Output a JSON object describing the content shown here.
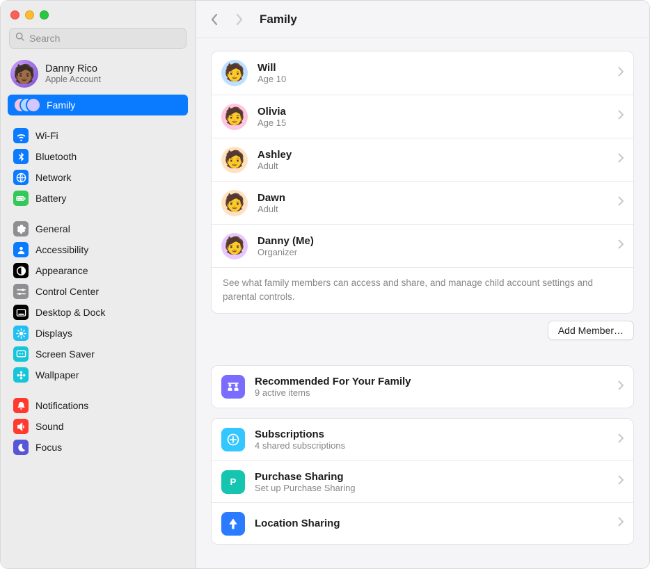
{
  "search": {
    "placeholder": "Search"
  },
  "account": {
    "name": "Danny Rico",
    "sub": "Apple Account"
  },
  "sidebar": {
    "family_label": "Family",
    "groups": [
      [
        {
          "label": "Wi-Fi",
          "color": "#0a7aff",
          "icon": "wifi"
        },
        {
          "label": "Bluetooth",
          "color": "#0a7aff",
          "icon": "bluetooth"
        },
        {
          "label": "Network",
          "color": "#0a7aff",
          "icon": "globe"
        },
        {
          "label": "Battery",
          "color": "#34c759",
          "icon": "battery"
        }
      ],
      [
        {
          "label": "General",
          "color": "#8e8e93",
          "icon": "gear"
        },
        {
          "label": "Accessibility",
          "color": "#0a7aff",
          "icon": "person"
        },
        {
          "label": "Appearance",
          "color": "#000000",
          "icon": "half"
        },
        {
          "label": "Control Center",
          "color": "#8e8e93",
          "icon": "sliders"
        },
        {
          "label": "Desktop & Dock",
          "color": "#000000",
          "icon": "dock"
        },
        {
          "label": "Displays",
          "color": "#23bff2",
          "icon": "sun"
        },
        {
          "label": "Screen Saver",
          "color": "#16c5d9",
          "icon": "screensaver"
        },
        {
          "label": "Wallpaper",
          "color": "#16c5d9",
          "icon": "flower"
        }
      ],
      [
        {
          "label": "Notifications",
          "color": "#ff3b30",
          "icon": "bell"
        },
        {
          "label": "Sound",
          "color": "#ff3b30",
          "icon": "speaker"
        },
        {
          "label": "Focus",
          "color": "#5856d6",
          "icon": "moon"
        }
      ]
    ]
  },
  "page": {
    "title": "Family"
  },
  "members": [
    {
      "name": "Will",
      "sub": "Age 10",
      "bg": "#bde0ff"
    },
    {
      "name": "Olivia",
      "sub": "Age 15",
      "bg": "#ffc4de"
    },
    {
      "name": "Ashley",
      "sub": "Adult",
      "bg": "#ffe1c0"
    },
    {
      "name": "Dawn",
      "sub": "Adult",
      "bg": "#ffe1c0"
    },
    {
      "name": "Danny (Me)",
      "sub": "Organizer",
      "bg": "#e6c8ff"
    }
  ],
  "members_footnote": "See what family members can access and share, and manage child account settings and parental controls.",
  "add_member_label": "Add Member…",
  "recommended": {
    "title": "Recommended For Your Family",
    "sub": "9 active items",
    "color": "#7a6cff"
  },
  "features": [
    {
      "title": "Subscriptions",
      "sub": "4 shared subscriptions",
      "color": "#34c6ff",
      "icon": "plus-circle"
    },
    {
      "title": "Purchase Sharing",
      "sub": "Set up Purchase Sharing",
      "color": "#16c5b0",
      "icon": "p"
    },
    {
      "title": "Location Sharing",
      "sub": "",
      "color": "#2a7bff",
      "icon": "arrow"
    }
  ]
}
